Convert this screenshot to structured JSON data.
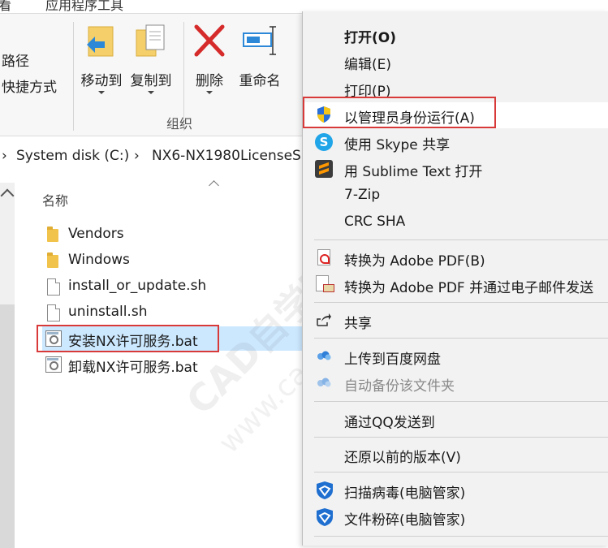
{
  "ribbon": {
    "top_tabs": [
      "看",
      "应用程序工具"
    ],
    "left_actions": [
      "路径",
      "快捷方式"
    ],
    "buttons": [
      "移动到",
      "复制到",
      "删除",
      "重命名"
    ],
    "group_label": "组织"
  },
  "address": {
    "segments": [
      "System disk (C:)",
      "NX6-NX1980LicenseS"
    ]
  },
  "file_pane": {
    "column_header": "名称",
    "files": [
      {
        "name": "Vendors",
        "icon": "folder-icon"
      },
      {
        "name": "Windows",
        "icon": "folder-icon"
      },
      {
        "name": "install_or_update.sh",
        "icon": "file-icon"
      },
      {
        "name": "uninstall.sh",
        "icon": "file-icon"
      },
      {
        "name": "安装NX许可服务.bat",
        "icon": "batch-file-icon",
        "selected": true
      },
      {
        "name": "卸载NX许可服务.bat",
        "icon": "batch-file-icon"
      }
    ]
  },
  "context_menu": {
    "items": [
      {
        "label": "打开(O)",
        "bold": true
      },
      {
        "label": "编辑(E)"
      },
      {
        "label": "打印(P)"
      },
      {
        "label": "以管理员身份运行(A)",
        "icon": "uac-shield-icon",
        "highlighted": true
      },
      {
        "label": "使用 Skype 共享",
        "icon": "skype-icon"
      },
      {
        "label": "用 Sublime Text 打开",
        "icon": "sublime-text-icon"
      },
      {
        "label": "7-Zip"
      },
      {
        "label": "CRC SHA"
      },
      {
        "label": "转换为 Adobe PDF(B)",
        "icon": "adobe-pdf-icon"
      },
      {
        "label": "转换为 Adobe PDF 并通过电子邮件发送",
        "icon": "adobe-pdf-mail-icon"
      },
      {
        "label": "共享",
        "icon": "share-icon"
      },
      {
        "label": "上传到百度网盘",
        "icon": "baidu-cloud-icon"
      },
      {
        "label": "自动备份该文件夹",
        "icon": "baidu-cloud-icon",
        "disabled": true
      },
      {
        "label": "通过QQ发送到"
      },
      {
        "label": "还原以前的版本(V)"
      },
      {
        "label": "扫描病毒(电脑管家)",
        "icon": "pc-manager-icon"
      },
      {
        "label": "文件粉碎(电脑管家)",
        "icon": "pc-manager-icon"
      }
    ]
  },
  "watermark": {
    "line1": "CAD自学网",
    "line2": "www.cadzxw.com"
  },
  "colors": {
    "highlight_border": "#d83a3a",
    "selection": "#cce8ff",
    "menu_bg": "#f2f2f2",
    "accent_blue": "#1f6fd0"
  }
}
